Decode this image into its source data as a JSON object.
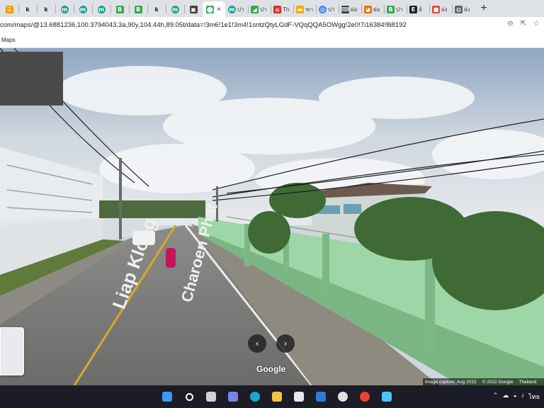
{
  "browser": {
    "tabs": [
      {
        "kind": "icon",
        "icon": "app-icon",
        "color": "#f29900",
        "glyph": "☰",
        "text": ""
      },
      {
        "kind": "icon",
        "icon": "k-icon",
        "color": "#ffffff",
        "glyph": "k",
        "text": ""
      },
      {
        "kind": "icon",
        "icon": "k-icon",
        "color": "#ffffff",
        "glyph": "k",
        "text": ""
      },
      {
        "kind": "icon",
        "icon": "m-circle-icon",
        "color": "#1a9e8f",
        "glyph": "m",
        "text": ""
      },
      {
        "kind": "icon",
        "icon": "m-circle-icon",
        "color": "#1a9e8f",
        "glyph": "m",
        "text": ""
      },
      {
        "kind": "icon",
        "icon": "m-circle-icon",
        "color": "#1a9e8f",
        "glyph": "m",
        "text": ""
      },
      {
        "kind": "icon",
        "icon": "b-icon",
        "color": "#34a853",
        "glyph": "B",
        "text": ""
      },
      {
        "kind": "icon",
        "icon": "b-icon",
        "color": "#34a853",
        "glyph": "B",
        "text": ""
      },
      {
        "kind": "icon",
        "icon": "k-icon",
        "color": "#ffffff",
        "glyph": "k",
        "text": ""
      },
      {
        "kind": "icon",
        "icon": "m-circle-icon",
        "color": "#1a9e8f",
        "glyph": "m",
        "text": ""
      },
      {
        "kind": "icon",
        "icon": "image-icon",
        "color": "#3c4043",
        "glyph": "▣",
        "text": ""
      },
      {
        "kind": "active",
        "icon": "maps-pin-icon",
        "color": "#34a853",
        "glyph": "⬤",
        "text": "",
        "close": "×"
      },
      {
        "kind": "wide",
        "icon": "m-circle-icon",
        "color": "#1a9e8f",
        "glyph": "m",
        "text": "ปา"
      },
      {
        "kind": "wide",
        "icon": "green-app-icon",
        "color": "#34a853",
        "glyph": "◢",
        "text": "ปา"
      },
      {
        "kind": "wide",
        "icon": "red-house-icon",
        "color": "#d93025",
        "glyph": "⌂",
        "text": "Th"
      },
      {
        "kind": "wide",
        "icon": "yellow-app-icon",
        "color": "#f9ab00",
        "glyph": "▬",
        "text": "ฑา"
      },
      {
        "kind": "wide",
        "icon": "blue-circle-icon",
        "color": "#4285f4",
        "glyph": "◎",
        "text": "ปา"
      },
      {
        "kind": "wide",
        "icon": "keyboard-icon",
        "color": "#3c4043",
        "glyph": "⌨",
        "text": "ฝอ"
      },
      {
        "kind": "wide",
        "icon": "orange-app-icon",
        "color": "#e8710a",
        "glyph": "◕",
        "text": "ฝอ"
      },
      {
        "kind": "wide",
        "icon": "b-icon",
        "color": "#34a853",
        "glyph": "B",
        "text": "ปา"
      },
      {
        "kind": "wide",
        "icon": "e-icon",
        "color": "#202124",
        "glyph": "E",
        "text": "ฮ้"
      },
      {
        "kind": "wide",
        "icon": "colorful-app-icon",
        "color": "#ea4335",
        "glyph": "■",
        "text": "ฝง"
      },
      {
        "kind": "wide",
        "icon": "globe-icon",
        "color": "#5f6368",
        "glyph": "◍",
        "text": "ฝง"
      }
    ],
    "new_tab_glyph": "+",
    "url": "com/maps/@13.6881236,100.3794043,3a,90y,104.44h,89.05t/data=!3m6!1e1!3m4!1sntzQtyLGdF-VQqQQA5OWgg!2e0!7i16384!8i8192",
    "bookmark": "Maps"
  },
  "streetview": {
    "road_text_1": "Liap Klong",
    "road_text_2": "Charoen Phat",
    "nav_left": "‹",
    "nav_right": "›",
    "logo": "Google",
    "image_capture": "Image capture: Aug 2022",
    "copyright": "© 2022 Google",
    "country": "Thailand"
  },
  "taskbar": {
    "apps": [
      "windows-start-icon",
      "search-icon",
      "task-view-icon",
      "chat-icon",
      "edge-icon",
      "file-explorer-icon",
      "store-icon",
      "mail-icon",
      "media-icon",
      "chrome-icon",
      "photos-icon"
    ],
    "tray_text": "ไทย"
  }
}
